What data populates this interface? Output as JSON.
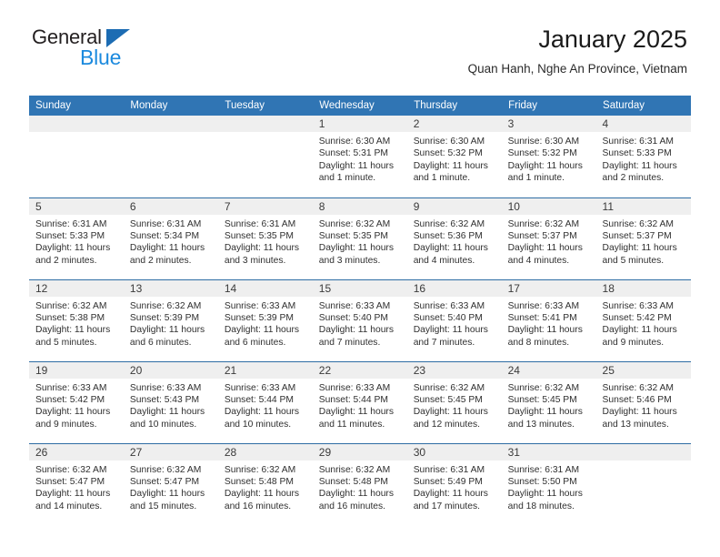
{
  "logo": {
    "word1": "General",
    "word2": "Blue",
    "triangle_icon": "triangle-icon",
    "accent_dark": "#1c6cb3",
    "accent_light": "#1c8ade"
  },
  "header": {
    "title": "January 2025",
    "subtitle": "Quan Hanh, Nghe An Province, Vietnam"
  },
  "theme": {
    "header_bg": "#3075b4",
    "row_divider": "#2e6da4",
    "daynum_bg": "#efefef"
  },
  "weekday_headers": [
    "Sunday",
    "Monday",
    "Tuesday",
    "Wednesday",
    "Thursday",
    "Friday",
    "Saturday"
  ],
  "weeks": [
    [
      {
        "day": "",
        "empty": true
      },
      {
        "day": "",
        "empty": true
      },
      {
        "day": "",
        "empty": true
      },
      {
        "day": "1",
        "sunrise": "Sunrise: 6:30 AM",
        "sunset": "Sunset: 5:31 PM",
        "daylight_l1": "Daylight: 11 hours",
        "daylight_l2": "and 1 minute."
      },
      {
        "day": "2",
        "sunrise": "Sunrise: 6:30 AM",
        "sunset": "Sunset: 5:32 PM",
        "daylight_l1": "Daylight: 11 hours",
        "daylight_l2": "and 1 minute."
      },
      {
        "day": "3",
        "sunrise": "Sunrise: 6:30 AM",
        "sunset": "Sunset: 5:32 PM",
        "daylight_l1": "Daylight: 11 hours",
        "daylight_l2": "and 1 minute."
      },
      {
        "day": "4",
        "sunrise": "Sunrise: 6:31 AM",
        "sunset": "Sunset: 5:33 PM",
        "daylight_l1": "Daylight: 11 hours",
        "daylight_l2": "and 2 minutes."
      }
    ],
    [
      {
        "day": "5",
        "sunrise": "Sunrise: 6:31 AM",
        "sunset": "Sunset: 5:33 PM",
        "daylight_l1": "Daylight: 11 hours",
        "daylight_l2": "and 2 minutes."
      },
      {
        "day": "6",
        "sunrise": "Sunrise: 6:31 AM",
        "sunset": "Sunset: 5:34 PM",
        "daylight_l1": "Daylight: 11 hours",
        "daylight_l2": "and 2 minutes."
      },
      {
        "day": "7",
        "sunrise": "Sunrise: 6:31 AM",
        "sunset": "Sunset: 5:35 PM",
        "daylight_l1": "Daylight: 11 hours",
        "daylight_l2": "and 3 minutes."
      },
      {
        "day": "8",
        "sunrise": "Sunrise: 6:32 AM",
        "sunset": "Sunset: 5:35 PM",
        "daylight_l1": "Daylight: 11 hours",
        "daylight_l2": "and 3 minutes."
      },
      {
        "day": "9",
        "sunrise": "Sunrise: 6:32 AM",
        "sunset": "Sunset: 5:36 PM",
        "daylight_l1": "Daylight: 11 hours",
        "daylight_l2": "and 4 minutes."
      },
      {
        "day": "10",
        "sunrise": "Sunrise: 6:32 AM",
        "sunset": "Sunset: 5:37 PM",
        "daylight_l1": "Daylight: 11 hours",
        "daylight_l2": "and 4 minutes."
      },
      {
        "day": "11",
        "sunrise": "Sunrise: 6:32 AM",
        "sunset": "Sunset: 5:37 PM",
        "daylight_l1": "Daylight: 11 hours",
        "daylight_l2": "and 5 minutes."
      }
    ],
    [
      {
        "day": "12",
        "sunrise": "Sunrise: 6:32 AM",
        "sunset": "Sunset: 5:38 PM",
        "daylight_l1": "Daylight: 11 hours",
        "daylight_l2": "and 5 minutes."
      },
      {
        "day": "13",
        "sunrise": "Sunrise: 6:32 AM",
        "sunset": "Sunset: 5:39 PM",
        "daylight_l1": "Daylight: 11 hours",
        "daylight_l2": "and 6 minutes."
      },
      {
        "day": "14",
        "sunrise": "Sunrise: 6:33 AM",
        "sunset": "Sunset: 5:39 PM",
        "daylight_l1": "Daylight: 11 hours",
        "daylight_l2": "and 6 minutes."
      },
      {
        "day": "15",
        "sunrise": "Sunrise: 6:33 AM",
        "sunset": "Sunset: 5:40 PM",
        "daylight_l1": "Daylight: 11 hours",
        "daylight_l2": "and 7 minutes."
      },
      {
        "day": "16",
        "sunrise": "Sunrise: 6:33 AM",
        "sunset": "Sunset: 5:40 PM",
        "daylight_l1": "Daylight: 11 hours",
        "daylight_l2": "and 7 minutes."
      },
      {
        "day": "17",
        "sunrise": "Sunrise: 6:33 AM",
        "sunset": "Sunset: 5:41 PM",
        "daylight_l1": "Daylight: 11 hours",
        "daylight_l2": "and 8 minutes."
      },
      {
        "day": "18",
        "sunrise": "Sunrise: 6:33 AM",
        "sunset": "Sunset: 5:42 PM",
        "daylight_l1": "Daylight: 11 hours",
        "daylight_l2": "and 9 minutes."
      }
    ],
    [
      {
        "day": "19",
        "sunrise": "Sunrise: 6:33 AM",
        "sunset": "Sunset: 5:42 PM",
        "daylight_l1": "Daylight: 11 hours",
        "daylight_l2": "and 9 minutes."
      },
      {
        "day": "20",
        "sunrise": "Sunrise: 6:33 AM",
        "sunset": "Sunset: 5:43 PM",
        "daylight_l1": "Daylight: 11 hours",
        "daylight_l2": "and 10 minutes."
      },
      {
        "day": "21",
        "sunrise": "Sunrise: 6:33 AM",
        "sunset": "Sunset: 5:44 PM",
        "daylight_l1": "Daylight: 11 hours",
        "daylight_l2": "and 10 minutes."
      },
      {
        "day": "22",
        "sunrise": "Sunrise: 6:33 AM",
        "sunset": "Sunset: 5:44 PM",
        "daylight_l1": "Daylight: 11 hours",
        "daylight_l2": "and 11 minutes."
      },
      {
        "day": "23",
        "sunrise": "Sunrise: 6:32 AM",
        "sunset": "Sunset: 5:45 PM",
        "daylight_l1": "Daylight: 11 hours",
        "daylight_l2": "and 12 minutes."
      },
      {
        "day": "24",
        "sunrise": "Sunrise: 6:32 AM",
        "sunset": "Sunset: 5:45 PM",
        "daylight_l1": "Daylight: 11 hours",
        "daylight_l2": "and 13 minutes."
      },
      {
        "day": "25",
        "sunrise": "Sunrise: 6:32 AM",
        "sunset": "Sunset: 5:46 PM",
        "daylight_l1": "Daylight: 11 hours",
        "daylight_l2": "and 13 minutes."
      }
    ],
    [
      {
        "day": "26",
        "sunrise": "Sunrise: 6:32 AM",
        "sunset": "Sunset: 5:47 PM",
        "daylight_l1": "Daylight: 11 hours",
        "daylight_l2": "and 14 minutes."
      },
      {
        "day": "27",
        "sunrise": "Sunrise: 6:32 AM",
        "sunset": "Sunset: 5:47 PM",
        "daylight_l1": "Daylight: 11 hours",
        "daylight_l2": "and 15 minutes."
      },
      {
        "day": "28",
        "sunrise": "Sunrise: 6:32 AM",
        "sunset": "Sunset: 5:48 PM",
        "daylight_l1": "Daylight: 11 hours",
        "daylight_l2": "and 16 minutes."
      },
      {
        "day": "29",
        "sunrise": "Sunrise: 6:32 AM",
        "sunset": "Sunset: 5:48 PM",
        "daylight_l1": "Daylight: 11 hours",
        "daylight_l2": "and 16 minutes."
      },
      {
        "day": "30",
        "sunrise": "Sunrise: 6:31 AM",
        "sunset": "Sunset: 5:49 PM",
        "daylight_l1": "Daylight: 11 hours",
        "daylight_l2": "and 17 minutes."
      },
      {
        "day": "31",
        "sunrise": "Sunrise: 6:31 AM",
        "sunset": "Sunset: 5:50 PM",
        "daylight_l1": "Daylight: 11 hours",
        "daylight_l2": "and 18 minutes."
      },
      {
        "day": "",
        "empty": true
      }
    ]
  ]
}
